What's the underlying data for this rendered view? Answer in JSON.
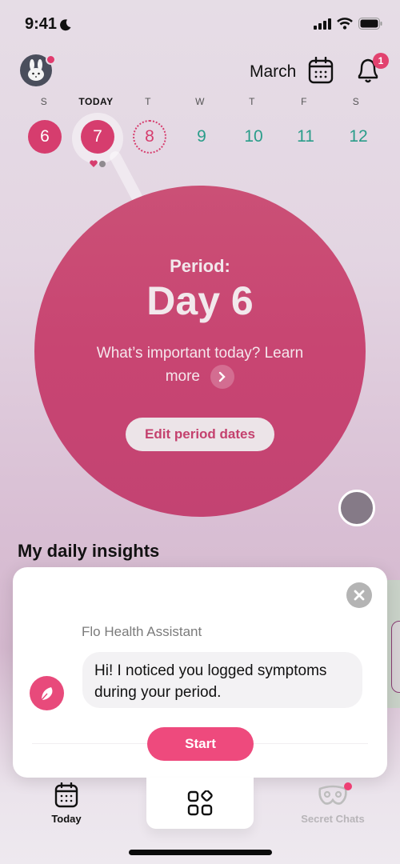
{
  "status_bar": {
    "time": "9:41",
    "icons": [
      "moon-icon",
      "signal-icon",
      "wifi-icon",
      "battery-icon"
    ]
  },
  "header": {
    "avatar_icon": "bunny-avatar-icon",
    "month": "March",
    "calendar_icon": "calendar-icon",
    "bell_icon": "bell-icon",
    "notification_count": "1"
  },
  "week": {
    "days": [
      {
        "weekday": "S",
        "date": "6",
        "state": "period"
      },
      {
        "weekday": "TODAY",
        "date": "7",
        "state": "period-today"
      },
      {
        "weekday": "T",
        "date": "8",
        "state": "predicted"
      },
      {
        "weekday": "W",
        "date": "9",
        "state": "fertile"
      },
      {
        "weekday": "T",
        "date": "10",
        "state": "fertile"
      },
      {
        "weekday": "F",
        "date": "11",
        "state": "fertile"
      },
      {
        "weekday": "S",
        "date": "12",
        "state": "fertile"
      }
    ],
    "today_markers": [
      "heart-icon",
      "dot-icon"
    ]
  },
  "cycle": {
    "label": "Period:",
    "day": "Day 6",
    "learn_more_text": "What’s important today? Learn more",
    "edit_button": "Edit period dates"
  },
  "insights": {
    "title": "My daily insights"
  },
  "assistant_popup": {
    "sender": "Flo Health Assistant",
    "message": "Hi! I noticed you logged symptoms during your period.",
    "start_button": "Start"
  },
  "tabbar": {
    "tabs": [
      {
        "label": "Today",
        "icon": "calendar-icon",
        "active": true
      },
      {
        "label": "",
        "icon": "apps-grid-icon",
        "active": false
      },
      {
        "label": "Secret Chats",
        "icon": "mask-icon",
        "active": false
      }
    ]
  },
  "colors": {
    "period": "#d63d6e",
    "fertile": "#2a9d8a",
    "accent_button": "#ee4a7d"
  }
}
